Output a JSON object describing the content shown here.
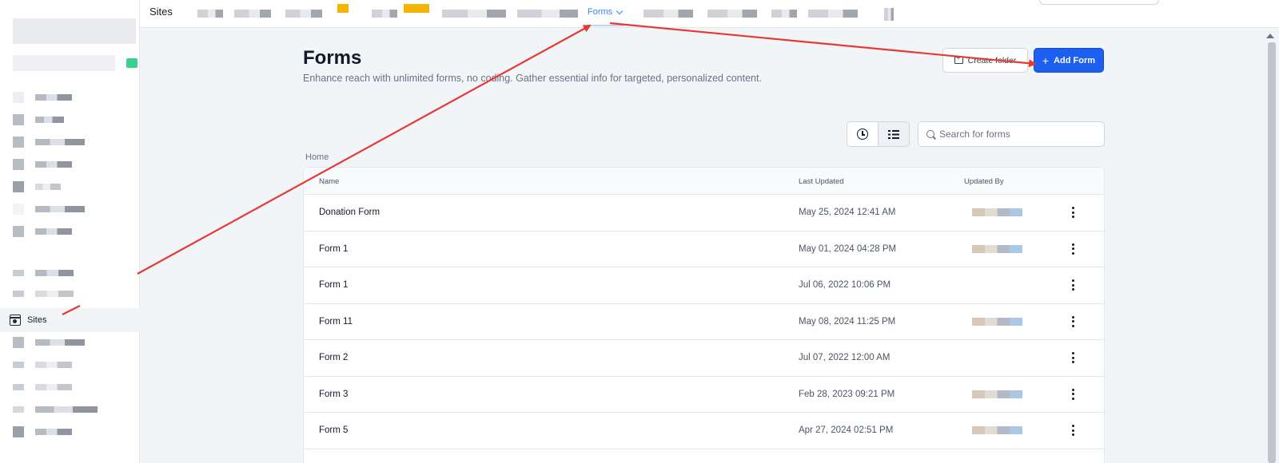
{
  "nav": {
    "title": "Sites",
    "active_tab": "Forms"
  },
  "sidebar": {
    "active_item": "Sites"
  },
  "page": {
    "title": "Forms",
    "description": "Enhance reach with unlimited forms, no coding. Gather essential info for targeted, personalized content."
  },
  "actions": {
    "create_folder": "Create folder",
    "add_form": "Add Form"
  },
  "search": {
    "placeholder": "Search for forms"
  },
  "breadcrumb": "Home",
  "table": {
    "headers": {
      "name": "Name",
      "updated": "Last Updated",
      "by": "Updated By"
    },
    "rows": [
      {
        "name": "Donation Form",
        "updated": "May 25, 2024 12:41 AM",
        "has_user": true
      },
      {
        "name": "Form 1",
        "updated": "May 01, 2024 04:28 PM",
        "has_user": true
      },
      {
        "name": "Form 1",
        "updated": "Jul 06, 2022 10:06 PM",
        "has_user": false
      },
      {
        "name": "Form 11",
        "updated": "May 08, 2024 11:25 PM",
        "has_user": true
      },
      {
        "name": "Form 2",
        "updated": "Jul 07, 2022 12:00 AM",
        "has_user": false
      },
      {
        "name": "Form 3",
        "updated": "Feb 28, 2023 09:21 PM",
        "has_user": true
      },
      {
        "name": "Form 5",
        "updated": "Apr 27, 2024 02:51 PM",
        "has_user": true
      }
    ]
  },
  "icons": {
    "view_recent": "clock-icon",
    "view_list": "list-icon",
    "search": "search-icon",
    "row_menu": "kebab-menu-icon",
    "sites": "sites-icon"
  },
  "colors": {
    "primary": "#1d5ff0",
    "link": "#3b82f6",
    "annotation": "#e53935"
  }
}
